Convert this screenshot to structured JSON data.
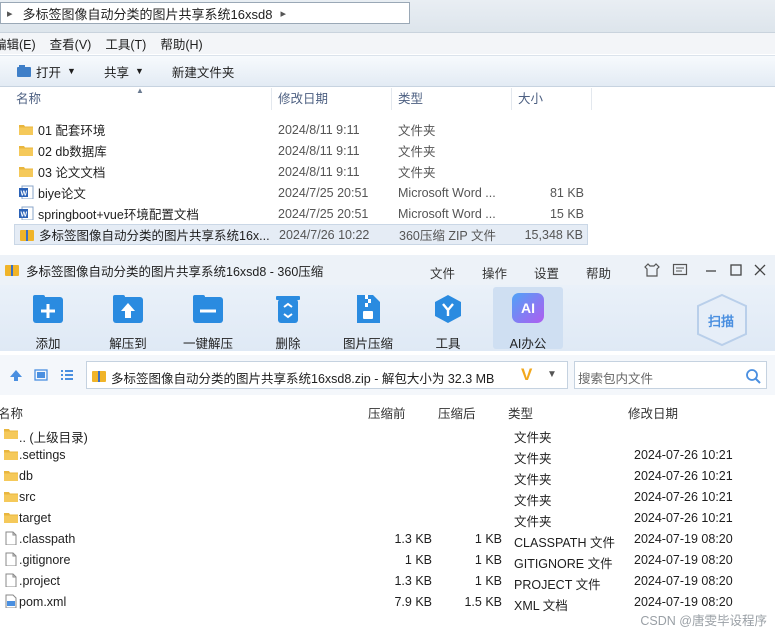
{
  "explorer": {
    "breadcrumb": "多标签图像自动分类的图片共享系统16xsd8",
    "menu": [
      "编辑(E)",
      "查看(V)",
      "工具(T)",
      "帮助(H)"
    ],
    "toolbar": {
      "open": "打开",
      "share": "共享",
      "new_folder": "新建文件夹"
    },
    "columns": {
      "name": "名称",
      "date": "修改日期",
      "type": "类型",
      "size": "大小"
    },
    "files": [
      {
        "name": "01 配套环境",
        "date": "2024/8/11 9:11",
        "type": "文件夹",
        "size": "",
        "icon": "folder"
      },
      {
        "name": "02 db数据库",
        "date": "2024/8/11 9:11",
        "type": "文件夹",
        "size": "",
        "icon": "folder"
      },
      {
        "name": "03 论文文档",
        "date": "2024/8/11 9:11",
        "type": "文件夹",
        "size": "",
        "icon": "folder"
      },
      {
        "name": "biye论文",
        "date": "2024/7/25 20:51",
        "type": "Microsoft Word ...",
        "size": "81 KB",
        "icon": "word"
      },
      {
        "name": "springboot+vue环境配置文档",
        "date": "2024/7/25 20:51",
        "type": "Microsoft Word ...",
        "size": "15 KB",
        "icon": "word"
      },
      {
        "name": "多标签图像自动分类的图片共享系统16x...",
        "date": "2024/7/26 10:22",
        "type": "360压缩 ZIP 文件",
        "size": "15,348 KB",
        "icon": "zip",
        "selected": true
      }
    ]
  },
  "zip": {
    "title": "多标签图像自动分类的图片共享系统16xsd8 - 360压缩",
    "menu": {
      "file": "文件",
      "ops": "操作",
      "settings": "设置",
      "help": "帮助"
    },
    "tools": {
      "add": "添加",
      "extract_to": "解压到",
      "one_click": "一键解压",
      "delete": "删除",
      "img_compress": "图片压缩",
      "tools": "工具",
      "ai_office": "AI办公",
      "ai_badge": "AI",
      "scan": "扫描"
    },
    "path": "多标签图像自动分类的图片共享系统16xsd8.zip - 解包大小为 32.3 MB",
    "search_placeholder": "搜索包内文件",
    "columns": {
      "name": "名称",
      "compressed": "压缩前",
      "uncompressed": "压缩后",
      "type": "类型",
      "modified": "修改日期"
    },
    "rows": [
      {
        "name": ".. (上级目录)",
        "cs": "",
        "us": "",
        "type": "文件夹",
        "mtime": "",
        "icon": "folder"
      },
      {
        "name": ".settings",
        "cs": "",
        "us": "",
        "type": "文件夹",
        "mtime": "2024-07-26 10:21",
        "icon": "folder"
      },
      {
        "name": "db",
        "cs": "",
        "us": "",
        "type": "文件夹",
        "mtime": "2024-07-26 10:21",
        "icon": "folder"
      },
      {
        "name": "src",
        "cs": "",
        "us": "",
        "type": "文件夹",
        "mtime": "2024-07-26 10:21",
        "icon": "folder"
      },
      {
        "name": "target",
        "cs": "",
        "us": "",
        "type": "文件夹",
        "mtime": "2024-07-26 10:21",
        "icon": "folder"
      },
      {
        "name": ".classpath",
        "cs": "1.3 KB",
        "us": "1 KB",
        "type": "CLASSPATH 文件",
        "mtime": "2024-07-19 08:20",
        "icon": "file"
      },
      {
        "name": ".gitignore",
        "cs": "1 KB",
        "us": "1 KB",
        "type": "GITIGNORE 文件",
        "mtime": "2024-07-19 08:20",
        "icon": "file"
      },
      {
        "name": ".project",
        "cs": "1.3 KB",
        "us": "1 KB",
        "type": "PROJECT 文件",
        "mtime": "2024-07-19 08:20",
        "icon": "file"
      },
      {
        "name": "pom.xml",
        "cs": "7.9 KB",
        "us": "1.5 KB",
        "type": "XML 文档",
        "mtime": "2024-07-19 08:20",
        "icon": "xml"
      }
    ]
  },
  "watermark": "CSDN @唐雯毕设程序"
}
